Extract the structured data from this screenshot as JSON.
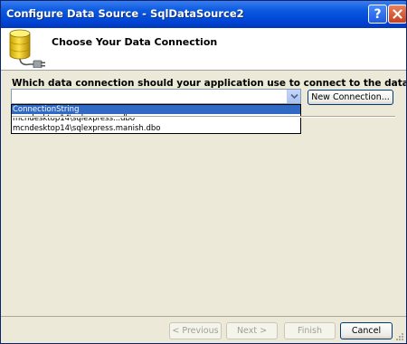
{
  "window": {
    "title": "Configure Data Source - SqlDataSource2",
    "help_glyph": "?"
  },
  "header": {
    "title": "Choose Your Data Connection"
  },
  "main": {
    "prompt": "Which data connection should your application use to connect to the database?",
    "connection_combo": {
      "value": "",
      "options": [
        "ConnectionString",
        "mcndesktop14\\sqlexpress...dbo",
        "mcndesktop14\\sqlexpress.manish.dbo"
      ],
      "highlighted_index": 0
    },
    "new_connection_label": "New Connection..."
  },
  "footer": {
    "previous_label": "< Previous",
    "next_label": "Next >",
    "finish_label": "Finish",
    "cancel_label": "Cancel"
  }
}
